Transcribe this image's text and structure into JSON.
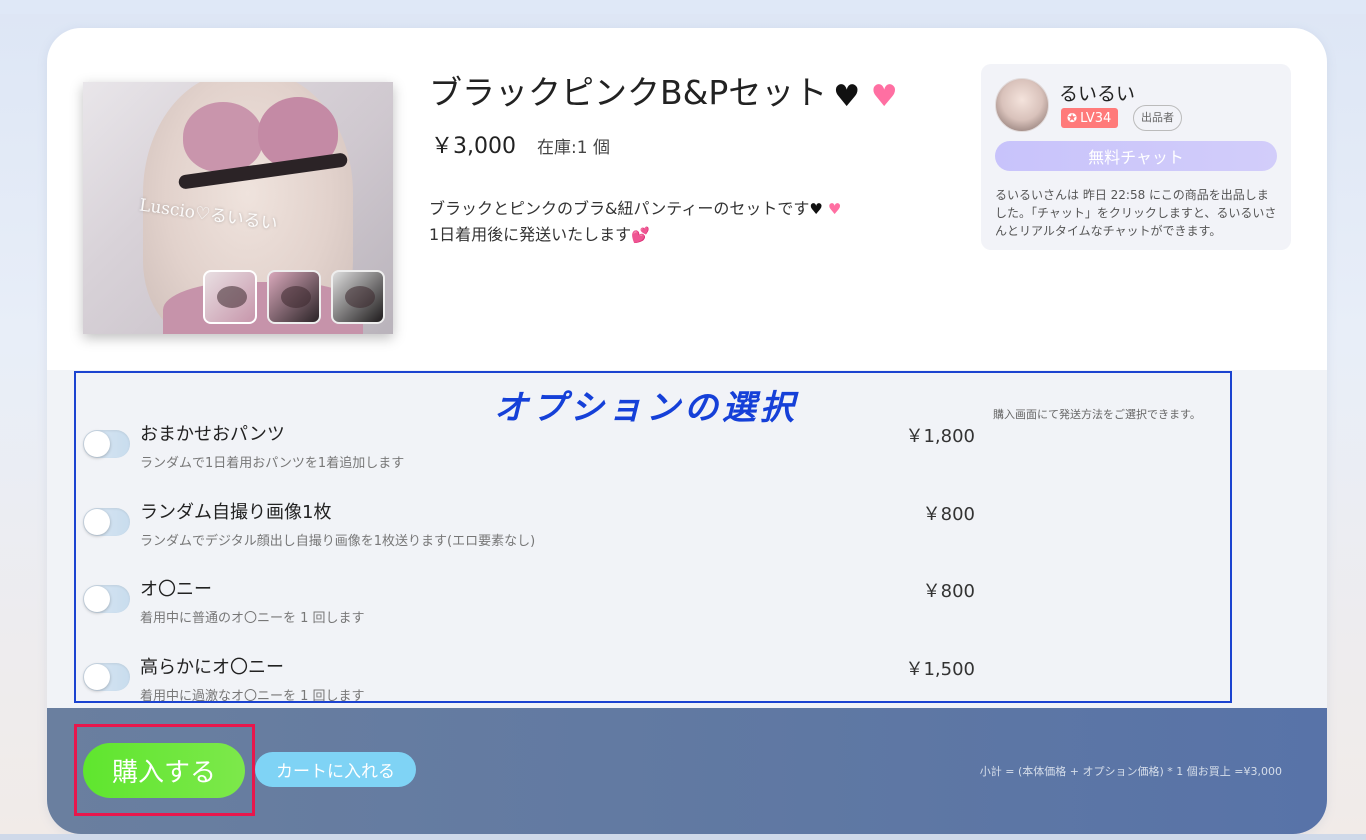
{
  "product": {
    "title": "ブラックピンクB&Pセット",
    "title_icons": [
      "black-heart-icon",
      "pink-heart-icon"
    ],
    "price": "￥3,000",
    "stock": "在庫:1 個",
    "description_line1": "ブラックとピンクのブラ&紐パンティーのセットです",
    "description_line2": "1日着用後に発送いたします",
    "image_watermark": "Luscio♡るいるい",
    "thumbnails": [
      "thumbnail-1",
      "thumbnail-2",
      "thumbnail-3"
    ]
  },
  "seller": {
    "name": "るいるい",
    "level": "LV34",
    "role": "出品者",
    "chat_button": "無料チャット",
    "note": "るいるいさんは 昨日 22:58 にこの商品を出品しました。「チャット」をクリックしますと、るいるいさんとリアルタイムなチャットができます。"
  },
  "options": {
    "title": "オプションの選択",
    "shipping_note": "購入画面にて発送方法をご選択できます。",
    "items": [
      {
        "name": "おまかせおパンツ",
        "description": "ランダムで1日着用おパンツを1着追加します",
        "price": "￥1,800",
        "enabled": false
      },
      {
        "name": "ランダム自撮り画像1枚",
        "description": "ランダムでデジタル顔出し自撮り画像を1枚送ります(エロ要素なし)",
        "price": "￥800",
        "enabled": false
      },
      {
        "name": "オ〇ニー",
        "description": "着用中に普通のオ〇ニーを 1 回します",
        "price": "￥800",
        "enabled": false
      },
      {
        "name": "高らかにオ〇ニー",
        "description": "着用中に過激なオ〇ニーを 1 回します",
        "price": "￥1,500",
        "enabled": false
      }
    ]
  },
  "footer": {
    "buy_button": "購入する",
    "cart_button": "カートに入れる",
    "subtotal": "小計 = (本体価格 + オプション価格) * 1 個お買上 =¥3,000"
  },
  "colors": {
    "options_title": "#1540d8",
    "highlight_border": "#e8174c",
    "buy_button": "#6ae43b",
    "cart_button": "#7fd3f5",
    "level_badge": "#ff7a7a",
    "chat_button": "#c8c3fb"
  }
}
